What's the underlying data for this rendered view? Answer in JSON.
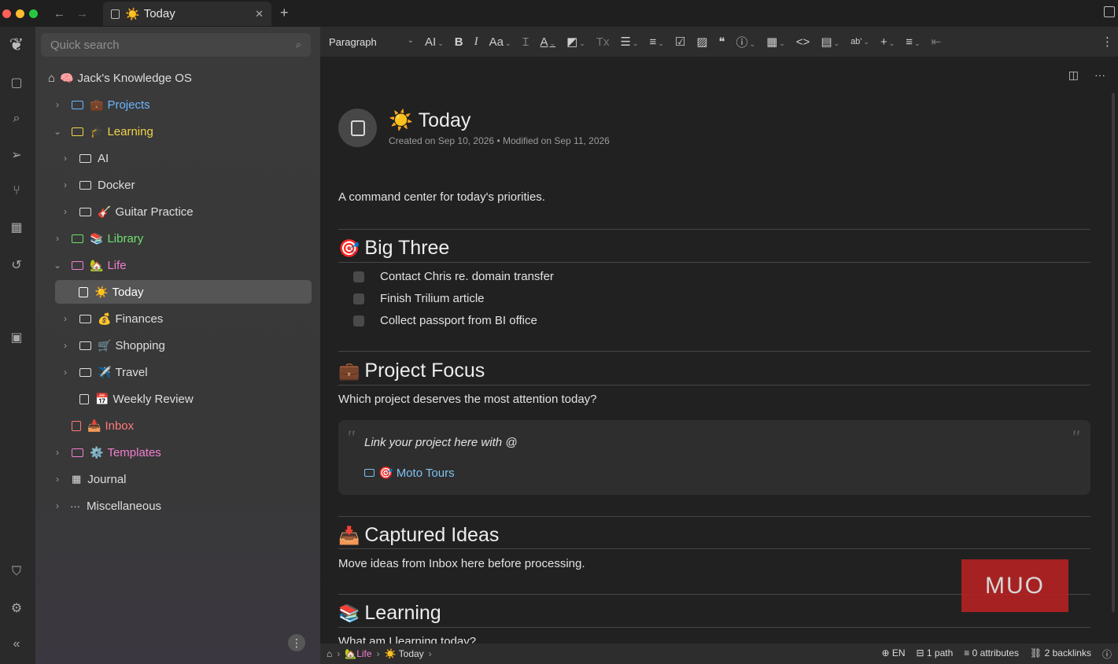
{
  "window": {
    "tab_title": "Today",
    "tab_emoji": "☀️"
  },
  "sidebar": {
    "search_placeholder": "Quick search",
    "root": {
      "emoji": "🧠",
      "label": "Jack's Knowledge OS"
    },
    "items": [
      {
        "label": "Projects",
        "emoji": "💼",
        "color": "#6cb6ff"
      },
      {
        "label": "Learning",
        "emoji": "🎓",
        "color": "#f2d34a"
      },
      {
        "label": "AI",
        "emoji": "",
        "color": "#dedede"
      },
      {
        "label": "Docker",
        "emoji": "",
        "color": "#dedede"
      },
      {
        "label": "Guitar Practice",
        "emoji": "🎸",
        "color": "#dedede"
      },
      {
        "label": "Library",
        "emoji": "📚",
        "color": "#6fe06f"
      },
      {
        "label": "Life",
        "emoji": "🏡",
        "color": "#f27fd0"
      },
      {
        "label": "Today",
        "emoji": "☀️",
        "color": "#ffffff"
      },
      {
        "label": "Finances",
        "emoji": "💰",
        "color": "#dedede"
      },
      {
        "label": "Shopping",
        "emoji": "🛒",
        "color": "#dedede"
      },
      {
        "label": "Travel",
        "emoji": "✈️",
        "color": "#dedede"
      },
      {
        "label": "Weekly Review",
        "emoji": "📅",
        "color": "#dedede"
      },
      {
        "label": "Inbox",
        "emoji": "📥",
        "color": "#ff7a7a"
      },
      {
        "label": "Templates",
        "emoji": "⚙️",
        "color": "#f27fd0"
      },
      {
        "label": "Journal",
        "emoji": "",
        "color": "#dedede"
      },
      {
        "label": "Miscellaneous",
        "emoji": "",
        "color": "#dedede"
      }
    ]
  },
  "toolbar": {
    "block_type": "Paragraph"
  },
  "note": {
    "title": "Today",
    "title_emoji": "☀️",
    "meta": "Created on Sep 10, 2026 • Modified on Sep 11, 2026",
    "intro": "A command center for today's priorities.",
    "sections": {
      "big_three": {
        "emoji": "🎯",
        "heading": "Big Three"
      },
      "project_focus": {
        "emoji": "💼",
        "heading": "Project Focus",
        "text": "Which project deserves the most attention today?"
      },
      "captured_ideas": {
        "emoji": "📥",
        "heading": "Captured Ideas",
        "text": "Move ideas from Inbox here before processing."
      },
      "learning": {
        "emoji": "📚",
        "heading": "Learning",
        "text": "What am I learning today?"
      }
    },
    "todos": [
      "Contact Chris re. domain transfer",
      "Finish Trilium article",
      "Collect passport from BI office"
    ],
    "quote": {
      "text": "Link your project here with @",
      "link_emoji": "🎯",
      "link_label": "Moto Tours"
    }
  },
  "watermark": "MUO",
  "statusbar": {
    "crumb_life": "Life",
    "crumb_life_emoji": "🏡",
    "crumb_today": "Today",
    "crumb_today_emoji": "☀️",
    "language": "EN",
    "paths": "1 path",
    "attributes": "0 attributes",
    "backlinks": "2 backlinks"
  }
}
